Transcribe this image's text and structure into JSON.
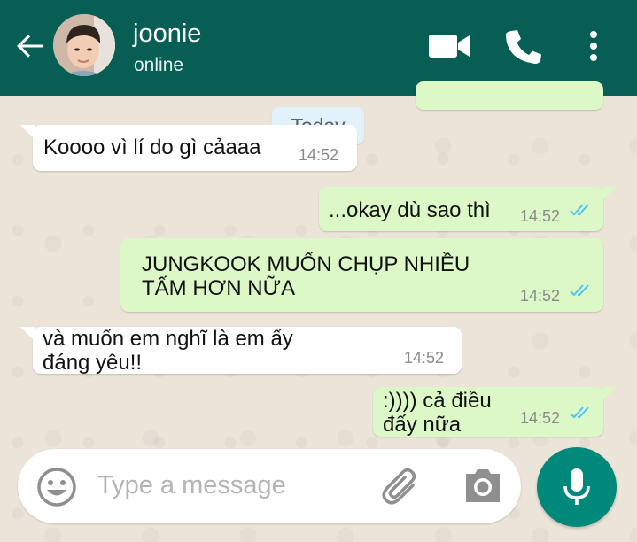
{
  "header": {
    "contact_name": "joonie",
    "status": "online"
  },
  "chat": {
    "date_label": "Today",
    "messages": [
      {
        "direction": "incoming",
        "text": "Koooo vì lí do gì cảaaa",
        "time": "14:52"
      },
      {
        "direction": "outgoing",
        "text": "...okay dù sao thì",
        "time": "14:52",
        "status": "read"
      },
      {
        "direction": "outgoing",
        "text_line1": "JUNGKOOK MUỐN CHỤP NHIỀU",
        "text_line2": "TẤM HƠN NỮA",
        "time": "14:52",
        "status": "read"
      },
      {
        "direction": "incoming",
        "text_line1": "và muốn em nghĩ là em ấy",
        "text_line2": "đáng yêu!!",
        "time": "14:52"
      },
      {
        "direction": "outgoing",
        "text_line1": ":)))) cả điều",
        "text_line2": "đấy nữa",
        "time": "14:52",
        "status": "read"
      }
    ]
  },
  "input": {
    "placeholder": "Type a message"
  },
  "icons": {
    "back": "arrow-left",
    "video": "videocam",
    "call": "phone",
    "menu": "more-vertical",
    "emoji": "smiley",
    "attach": "paperclip",
    "camera": "camera",
    "mic": "microphone"
  },
  "colors": {
    "header": "#075e54",
    "outgoing_bubble": "#dcf8c6",
    "incoming_bubble": "#ffffff",
    "read_ticks": "#4fc3f7",
    "mic_button": "#00897b"
  }
}
